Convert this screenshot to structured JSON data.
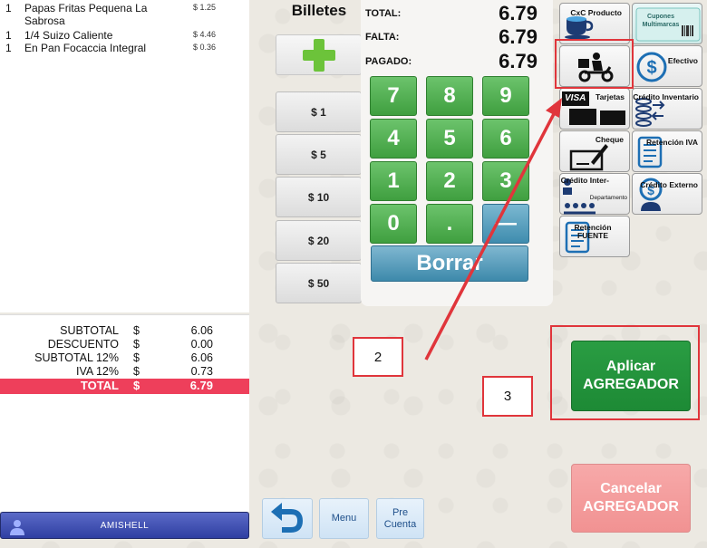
{
  "order": {
    "lines": [
      {
        "qty": "1",
        "desc": "Papas Fritas Pequena La Sabrosa",
        "price": "$ 1.25"
      },
      {
        "qty": "1",
        "desc": "1/4 Suizo Caliente",
        "price": "$ 4.46"
      },
      {
        "qty": "1",
        "desc": "En Pan Focaccia Integral",
        "price": "$ 0.36"
      }
    ]
  },
  "totals": [
    {
      "label": "SUBTOTAL",
      "cur": "$",
      "value": "6.06"
    },
    {
      "label": "DESCUENTO",
      "cur": "$",
      "value": "0.00"
    },
    {
      "label": "SUBTOTAL 12%",
      "cur": "$",
      "value": "6.06"
    },
    {
      "label": "IVA 12%",
      "cur": "$",
      "value": "0.73"
    },
    {
      "label": "TOTAL",
      "cur": "$",
      "value": "6.79"
    }
  ],
  "user": {
    "name": "AMISHELL"
  },
  "billetes": {
    "title": "Billetes",
    "buttons": [
      "$ 1",
      "$ 5",
      "$ 10",
      "$ 20",
      "$ 50"
    ]
  },
  "payment": {
    "total_label": "TOTAL:",
    "total_value": "6.79",
    "falta_label": "FALTA:",
    "falta_value": "6.79",
    "pagado_label": "PAGADO:",
    "pagado_value": "6.79",
    "keys": [
      "7",
      "8",
      "9",
      "4",
      "5",
      "6",
      "1",
      "2",
      "3",
      "0",
      ".",
      "—"
    ],
    "borrar_label": "Borrar"
  },
  "tiles": {
    "cxc_label": "CxC Producto",
    "cupones_label": "Cupones Multimarcas",
    "efectivo_label": "Efectivo",
    "tarjetas_label": "Tarjetas",
    "visa_text": "VISA",
    "credito_inventario_label": "Crédito Inventario",
    "cheque_label": "Cheque",
    "retencion_iva_label": "Retención IVA",
    "credito_inter_label": "Crédito Inter-",
    "credito_inter_sub": "Departamento",
    "credito_externo_label": "Crédito Externo",
    "retencion_fuente_label": "Retención FUENTE"
  },
  "annotations": {
    "callout_2": "2",
    "callout_3": "3"
  },
  "actions": {
    "apply_line1": "Aplicar",
    "apply_line2": "AGREGADOR",
    "cancel_line1": "Cancelar",
    "cancel_line2": "AGREGADOR"
  },
  "bottom": {
    "menu_label": "Menu",
    "pre_line1": "Pre",
    "pre_line2": "Cuenta"
  },
  "colors": {
    "accent_red": "#e0353b",
    "total_bar": "#ee3f5b",
    "key_green": "#4caf50",
    "apply_green": "#2a9d43"
  }
}
